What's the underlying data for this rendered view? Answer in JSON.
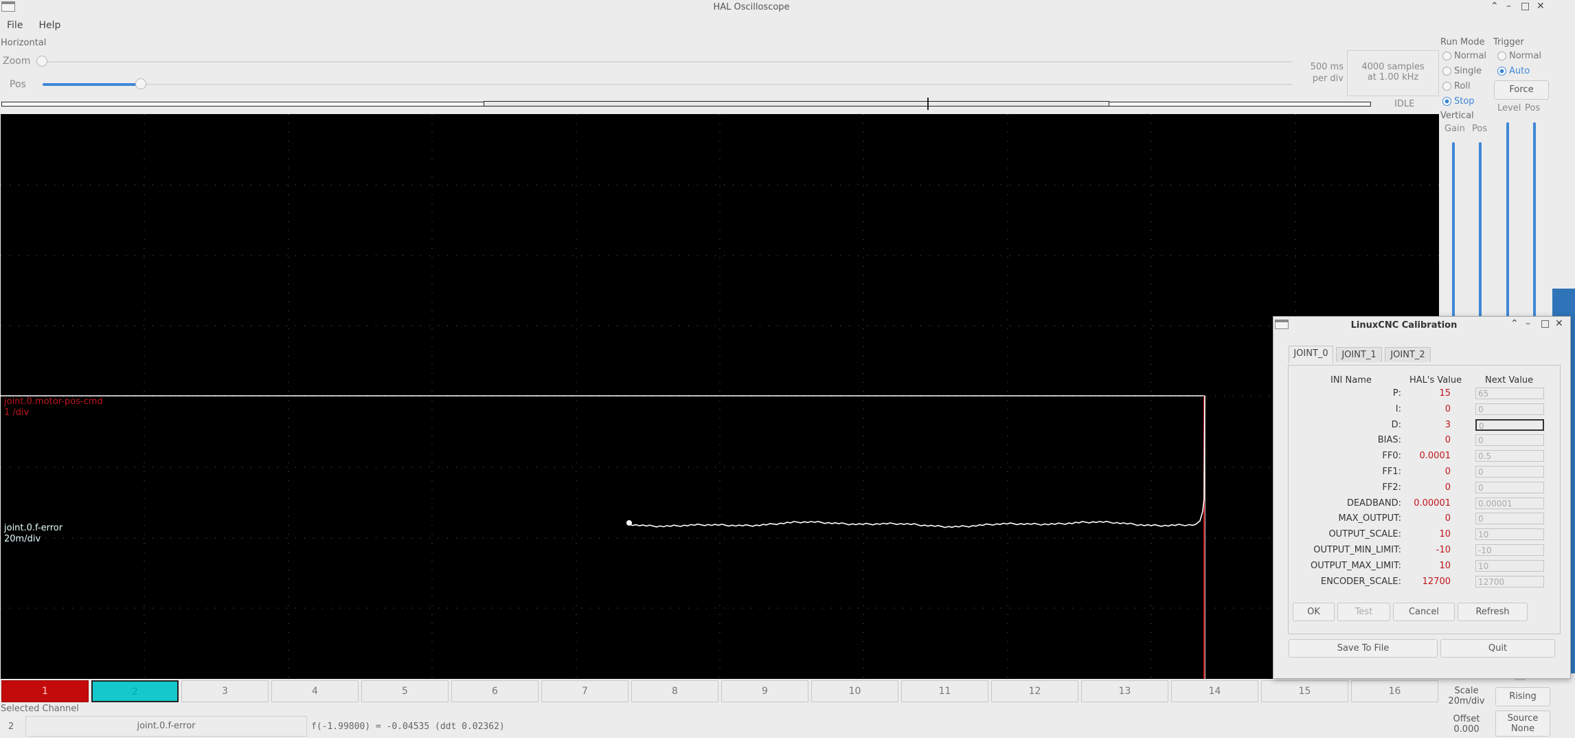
{
  "window": {
    "title": "HAL Oscilloscope"
  },
  "menu": {
    "file": "File",
    "help": "Help"
  },
  "horizontal": {
    "label": "Horizontal",
    "zoom_label": "Zoom",
    "pos_label": "Pos",
    "zoom_value": 0.0,
    "pos_value": 0.08,
    "rate_line1": "500 ms",
    "rate_line2": "per div",
    "samples_line1": "4000 samples",
    "samples_line2": "at 1.00 kHz",
    "status": "IDLE"
  },
  "run_mode": {
    "label": "Run Mode",
    "options": [
      "Normal",
      "Single",
      "Roll",
      "Stop"
    ],
    "selected": "Stop"
  },
  "trigger": {
    "label": "Trigger",
    "options": [
      "Normal",
      "Auto"
    ],
    "selected": "Auto",
    "force": "Force",
    "level_label": "Level",
    "pos_label": "Pos",
    "rising": "Rising",
    "source_line1": "Source",
    "source_line2": "None"
  },
  "vertical": {
    "label": "Vertical",
    "gain_label": "Gain",
    "pos_label": "Pos",
    "scale_line1": "Scale",
    "scale_line2": "20m/div",
    "offset_line1": "Offset",
    "offset_line2": "0.000",
    "dash": "----"
  },
  "traces": {
    "ch1_name": "joint.0.motor-pos-cmd",
    "ch1_scale": "1 /div",
    "ch1_color": "#c0141b",
    "ch2_name": "joint.0.f-error",
    "ch2_scale": "20m/div",
    "ch2_color": "#bff3f4"
  },
  "channels": [
    "1",
    "2",
    "3",
    "4",
    "5",
    "6",
    "7",
    "8",
    "9",
    "10",
    "11",
    "12",
    "13",
    "14",
    "15",
    "16"
  ],
  "selected_channel": {
    "label": "Selected Channel",
    "number": "2",
    "name": "joint.0.f-error",
    "readout": "f(-1.99800) = -0.04535 (ddt  0.02362)"
  },
  "calibration": {
    "title": "LinuxCNC Calibration",
    "tabs": [
      "JOINT_0",
      "JOINT_1",
      "JOINT_2"
    ],
    "headers": {
      "name": "INI Name",
      "hal": "HAL's Value",
      "next": "Next Value"
    },
    "rows": [
      {
        "name": "P:",
        "hal": "15",
        "next": "65"
      },
      {
        "name": "I:",
        "hal": "0",
        "next": "0"
      },
      {
        "name": "D:",
        "hal": "3",
        "next": "0"
      },
      {
        "name": "BIAS:",
        "hal": "0",
        "next": "0"
      },
      {
        "name": "FF0:",
        "hal": "0.0001",
        "next": "0.5"
      },
      {
        "name": "FF1:",
        "hal": "0",
        "next": "0"
      },
      {
        "name": "FF2:",
        "hal": "0",
        "next": "0"
      },
      {
        "name": "DEADBAND:",
        "hal": "0.00001",
        "next": "0.00001"
      },
      {
        "name": "MAX_OUTPUT:",
        "hal": "0",
        "next": "0"
      },
      {
        "name": "OUTPUT_SCALE:",
        "hal": "10",
        "next": "10"
      },
      {
        "name": "OUTPUT_MIN_LIMIT:",
        "hal": "-10",
        "next": "-10"
      },
      {
        "name": "OUTPUT_MAX_LIMIT:",
        "hal": "10",
        "next": "10"
      },
      {
        "name": "ENCODER_SCALE:",
        "hal": "12700",
        "next": "12700"
      }
    ],
    "buttons": {
      "ok": "OK",
      "test": "Test",
      "cancel": "Cancel",
      "refresh": "Refresh",
      "save": "Save To File",
      "quit": "Quit"
    }
  },
  "colors": {
    "accent": "#3f87d6",
    "channel1": "#c40b0b",
    "channel2": "#14c8cc"
  }
}
